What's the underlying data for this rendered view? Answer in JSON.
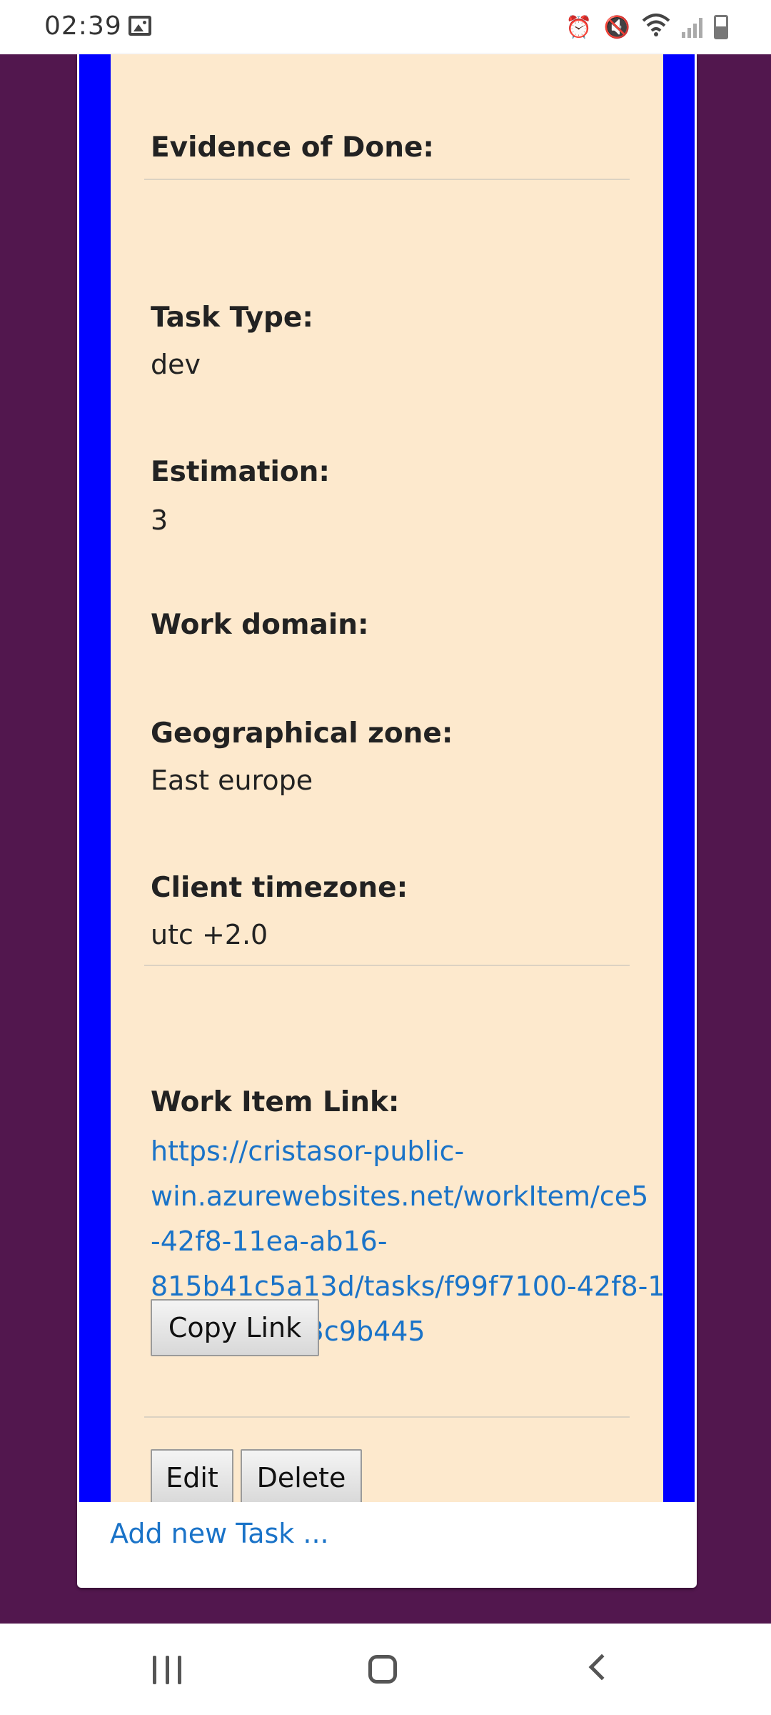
{
  "status_bar": {
    "time": "02:39",
    "icons": [
      "image-icon",
      "alarm-icon",
      "mute-icon",
      "wifi-icon",
      "signal-icon",
      "battery-icon"
    ]
  },
  "task": {
    "evidence_label": "Evidence of Done:",
    "task_type_label": "Task Type:",
    "task_type_value": "dev",
    "estimation_label": "Estimation:",
    "estimation_value": "3",
    "work_domain_label": "Work domain:",
    "geo_zone_label": "Geographical zone:",
    "geo_zone_value": "East europe",
    "timezone_label": "Client timezone:",
    "timezone_value": "utc +2.0",
    "work_item_link_label": "Work Item Link:",
    "work_item_link_lines": [
      "https://cristasor-public-",
      "win.azurewebsites.net/workItem/ce5",
      "-42f8-11ea-ab16-",
      "815b41c5a13d/tasks/f99f7100-42f8-1",
      "b69e-3bfa63c9b445"
    ],
    "copy_link_label": "Copy Link",
    "edit_label": "Edit",
    "delete_label": "Delete"
  },
  "footer": {
    "add_task_label": "Add new Task ..."
  },
  "colors": {
    "page_background": "#52174e",
    "task_frame": "#0000ff",
    "task_background": "#fde9cd",
    "link": "#1a73c8"
  }
}
